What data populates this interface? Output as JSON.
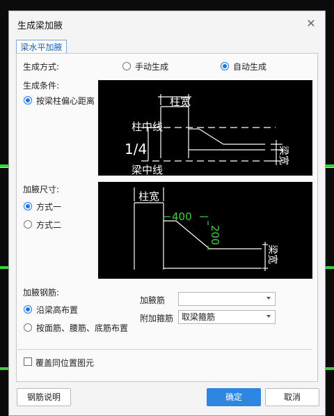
{
  "dialog": {
    "title": "生成梁加腋",
    "tab_label": "梁水平加腋"
  },
  "generation_mode": {
    "label": "生成方式:",
    "options": [
      {
        "label": "手动生成",
        "selected": false
      },
      {
        "label": "自动生成",
        "selected": true
      }
    ]
  },
  "generation_condition": {
    "label": "生成条件:",
    "option": {
      "label": "按梁柱偏心距离",
      "selected": true
    },
    "diagram": {
      "column_width": "柱宽",
      "column_centerline": "柱中线",
      "fraction": "1/4",
      "beam_centerline": "梁中线",
      "beam_width": "梁宽"
    }
  },
  "haunch_size": {
    "label": "加腋尺寸:",
    "options": [
      {
        "label": "方式一",
        "selected": true
      },
      {
        "label": "方式二",
        "selected": false
      }
    ],
    "diagram": {
      "column_width": "柱宽",
      "dim_horizontal": "400",
      "dim_vertical": "200",
      "beam_width": "梁宽"
    }
  },
  "haunch_rebar": {
    "label": "加腋钢筋:",
    "options": [
      {
        "label": "沿梁高布置",
        "selected": true
      },
      {
        "label": "按面筋、腰筋、底筋布置",
        "selected": false
      }
    ],
    "haunch_bar_label": "加腋筋",
    "haunch_bar_value": "",
    "stirrup_label": "附加箍筋",
    "stirrup_value": "取梁箍筋"
  },
  "overwrite": {
    "label": "覆盖同位置图元",
    "checked": false
  },
  "buttons": {
    "rebar_help": "钢筋说明",
    "ok": "确定",
    "cancel": "取消"
  },
  "colors": {
    "accent": "#2f86e0",
    "diagram_green": "#3cd23c",
    "background_green": "#39d339"
  }
}
